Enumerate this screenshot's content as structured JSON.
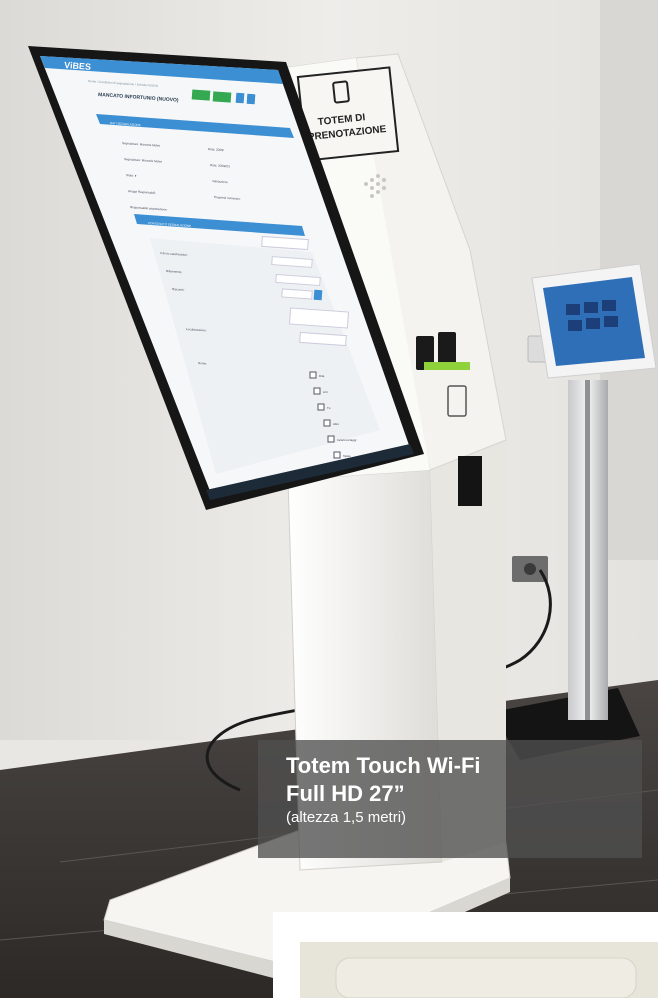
{
  "screen_app": {
    "brand": "ViBES",
    "breadcrumb": "Home / Condizioni di segnalazione / Scheda NUOVA",
    "title": "MANCATO INFORTUNIO (NUOVO)",
    "section_header": "DATI SEGNALAZIONE",
    "fields_left": [
      "Segnalatore: Manuele Molini",
      "Segnalatore: Manuele Molini",
      "Stato: ●",
      "Gruppi Responsabili:",
      "Responsabile segnalazione:"
    ],
    "fields_right": [
      "Data: 20/08",
      "Data: 20/08/23",
      "Valutazione:",
      "Proprietà numerato:"
    ],
    "subsection_header": "CONTENUTO SEGNALAZIONE",
    "form_labels": [
      "Il di ivo cascherizion:",
      "Riferimento:",
      "Riscontri:",
      "Localizzazione:",
      "Nome:"
    ],
    "checkbox_labels": [
      "Dita",
      "Arti",
      "Tu",
      "Altro",
      "Incarico-Naggi",
      "Tasks"
    ]
  },
  "totem": {
    "label_line1": "TOTEM DI",
    "label_line2": "PRENOTAZIONE"
  },
  "caption": {
    "line1": "Totem Touch Wi-Fi",
    "line2": "Full HD 27”",
    "line3": "(altezza 1,5 metri)"
  },
  "colors": {
    "wall": "#ecebe8",
    "floor": "#3a3634",
    "totem_white": "#f3f2ee",
    "screen_bezel": "#161616",
    "app_blue": "#3b8fd2",
    "app_green": "#35a852",
    "tablet_blue": "#2f6fb8",
    "caption_bg": "#505050"
  }
}
